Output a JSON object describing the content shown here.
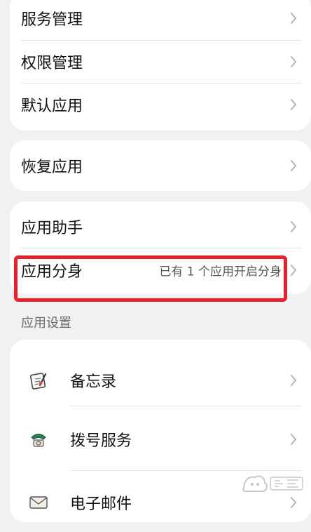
{
  "card1": {
    "items": [
      {
        "label": "服务管理"
      },
      {
        "label": "权限管理"
      },
      {
        "label": "默认应用"
      }
    ]
  },
  "card2": {
    "items": [
      {
        "label": "恢复应用"
      }
    ]
  },
  "card3": {
    "items": [
      {
        "label": "应用助手"
      },
      {
        "label": "应用分身",
        "value": "已有 1 个应用开启分身"
      }
    ]
  },
  "app_settings": {
    "header": "应用设置",
    "items": [
      {
        "label": "备忘录",
        "icon": "memo-icon"
      },
      {
        "label": "拨号服务",
        "icon": "phone-icon"
      },
      {
        "label": "电子邮件",
        "icon": "mail-icon"
      }
    ]
  },
  "colors": {
    "highlight": "#e8202c",
    "background": "#f1f1f3",
    "card": "#ffffff"
  }
}
